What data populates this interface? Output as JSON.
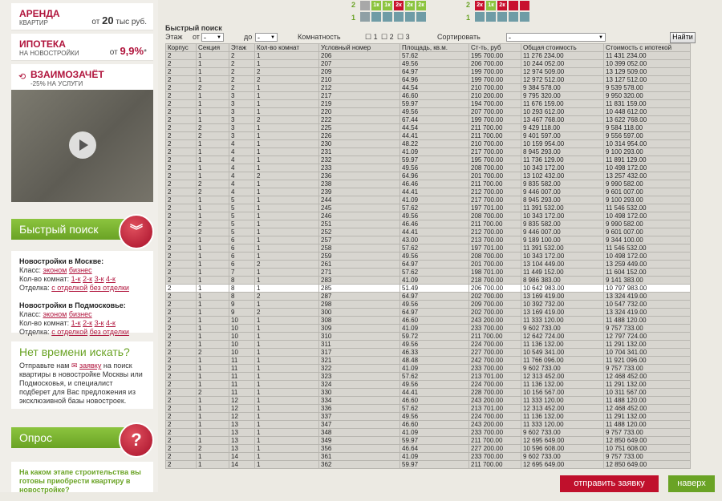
{
  "promos": [
    {
      "title": "АРЕНДА",
      "sub": "КВАРТИР",
      "right_pre": "от ",
      "right_num": "20",
      "right_post": " тыс руб."
    },
    {
      "title": "ИПОТЕКА",
      "sub": "НА НОВОСТРОЙКИ",
      "right_pre": "от ",
      "right_num": "9,9%",
      "right_post": "*"
    },
    {
      "title": "ВЗАИМОЗАЧЁТ",
      "sub": "-25% НА УСЛУГИ",
      "right_pre": "",
      "right_num": "",
      "right_post": ""
    }
  ],
  "quick_search_title": "Быстрый поиск",
  "moscow": {
    "heading": "Новостройки в Москве:",
    "class_label": "Класс:",
    "class_links": [
      "эконом",
      "бизнес"
    ],
    "rooms_label": "Кол-во комнат:",
    "rooms_links": [
      "1-к",
      "2-к",
      "3-к",
      "4-к"
    ],
    "finish_label": "Отделка:",
    "finish_links": [
      "с отделкой",
      "без отделки"
    ]
  },
  "mo": {
    "heading": "Новостройки в Подмосковье:",
    "class_label": "Класс:",
    "class_links": [
      "эконом",
      "бизнес"
    ],
    "rooms_label": "Кол-во комнат:",
    "rooms_links": [
      "1-к",
      "2-к",
      "3-к",
      "4-к"
    ],
    "finish_label": "Отделка:",
    "finish_links": [
      "с отделкой",
      "без отделки"
    ]
  },
  "no_time": {
    "title": "Нет времени искать?",
    "text_pre": "Отправьте нам ",
    "link": "заявку",
    "text_post": " на поиск квартиры в новостройке Москвы или Подмосковья, и специалист подберет для Вас предложения из эксклюзивной базы новостроек."
  },
  "poll_title": "Опрос",
  "poll_question": "На каком этапе строительства вы готовы приобрести квартиру в новостройке?",
  "floor_labels": [
    "2",
    "1",
    "2",
    "1"
  ],
  "grid_badges": [
    "1к",
    "1к",
    "2к",
    "2к",
    "2к",
    "2к",
    "1к",
    "2к"
  ],
  "filters": {
    "title": "Быстрый поиск",
    "floor": "Этаж",
    "from": "от",
    "from_val": "-",
    "to": "до",
    "to_val": "-",
    "rooms": "Комнатность",
    "r1": "1",
    "r2": "2",
    "r3": "3",
    "sort": "Сортировать",
    "sort_val": "-",
    "find": "Найти"
  },
  "columns": [
    "Корпус",
    "Секция",
    "Этаж",
    "Кол-во комнат",
    "Условный номер",
    "Площадь, кв.м.",
    "Ст-ть, руб",
    "Общая стоимость",
    "Стоимость с ипотекой"
  ],
  "rows": [
    [
      "2",
      "1",
      "2",
      "1",
      "206",
      "57.62",
      "195 700.00",
      "11 276 234.00",
      "11 431 234.00"
    ],
    [
      "2",
      "1",
      "2",
      "1",
      "207",
      "49.56",
      "206 700.00",
      "10 244 052.00",
      "10 399 052.00"
    ],
    [
      "2",
      "1",
      "2",
      "2",
      "209",
      "64.97",
      "199 700.00",
      "12 974 509.00",
      "13 129 509.00"
    ],
    [
      "2",
      "1",
      "2",
      "2",
      "210",
      "64.96",
      "199 700.00",
      "12 972 512.00",
      "13 127 512.00"
    ],
    [
      "2",
      "2",
      "2",
      "1",
      "212",
      "44.54",
      "210 700.00",
      "9 384 578.00",
      "9 539 578.00"
    ],
    [
      "2",
      "1",
      "3",
      "1",
      "217",
      "46.60",
      "210 200.00",
      "9 795 320.00",
      "9 950 320.00"
    ],
    [
      "2",
      "1",
      "3",
      "1",
      "219",
      "59.97",
      "194 700.00",
      "11 676 159.00",
      "11 831 159.00"
    ],
    [
      "2",
      "1",
      "3",
      "1",
      "220",
      "49.56",
      "207 700.00",
      "10 293 612.00",
      "10 448 612.00"
    ],
    [
      "2",
      "1",
      "3",
      "2",
      "222",
      "67.44",
      "199 700.00",
      "13 467 768.00",
      "13 622 768.00"
    ],
    [
      "2",
      "2",
      "3",
      "1",
      "225",
      "44.54",
      "211 700.00",
      "9 429 118.00",
      "9 584 118.00"
    ],
    [
      "2",
      "2",
      "3",
      "1",
      "226",
      "44.41",
      "211 700.00",
      "9 401 597.00",
      "9 556 597.00"
    ],
    [
      "2",
      "1",
      "4",
      "1",
      "230",
      "48.22",
      "210 700.00",
      "10 159 954.00",
      "10 314 954.00"
    ],
    [
      "2",
      "1",
      "4",
      "1",
      "231",
      "41.09",
      "217 700.00",
      "8 945 293.00",
      "9 100 293.00"
    ],
    [
      "2",
      "1",
      "4",
      "1",
      "232",
      "59.97",
      "195 700.00",
      "11 736 129.00",
      "11 891 129.00"
    ],
    [
      "2",
      "1",
      "4",
      "1",
      "233",
      "49.56",
      "208 700.00",
      "10 343 172.00",
      "10 498 172.00"
    ],
    [
      "2",
      "1",
      "4",
      "2",
      "236",
      "64.96",
      "201 700.00",
      "13 102 432.00",
      "13 257 432.00"
    ],
    [
      "2",
      "2",
      "4",
      "1",
      "238",
      "46.46",
      "211 700.00",
      "9 835 582.00",
      "9 990 582.00"
    ],
    [
      "2",
      "2",
      "4",
      "1",
      "239",
      "44.41",
      "212 700.00",
      "9 446 007.00",
      "9 601 007.00"
    ],
    [
      "2",
      "1",
      "5",
      "1",
      "244",
      "41.09",
      "217 700.00",
      "8 945 293.00",
      "9 100 293.00"
    ],
    [
      "2",
      "1",
      "5",
      "1",
      "245",
      "57.62",
      "197 701.00",
      "11 391 532.00",
      "11 546 532.00"
    ],
    [
      "2",
      "1",
      "5",
      "1",
      "246",
      "49.56",
      "208 700.00",
      "10 343 172.00",
      "10 498 172.00"
    ],
    [
      "2",
      "2",
      "5",
      "1",
      "251",
      "46.46",
      "211 700.00",
      "9 835 582.00",
      "9 990 582.00"
    ],
    [
      "2",
      "2",
      "5",
      "1",
      "252",
      "44.41",
      "212 700.00",
      "9 446 007.00",
      "9 601 007.00"
    ],
    [
      "2",
      "1",
      "6",
      "1",
      "257",
      "43.00",
      "213 700.00",
      "9 189 100.00",
      "9 344 100.00"
    ],
    [
      "2",
      "1",
      "6",
      "1",
      "258",
      "57.62",
      "197 701.00",
      "11 391 532.00",
      "11 546 532.00"
    ],
    [
      "2",
      "1",
      "6",
      "1",
      "259",
      "49.56",
      "208 700.00",
      "10 343 172.00",
      "10 498 172.00"
    ],
    [
      "2",
      "1",
      "6",
      "2",
      "261",
      "64.97",
      "201 700.00",
      "13 104 449.00",
      "13 259 449.00"
    ],
    [
      "2",
      "1",
      "7",
      "1",
      "271",
      "57.62",
      "198 701.00",
      "11 449 152.00",
      "11 604 152.00"
    ],
    [
      "2",
      "1",
      "8",
      "1",
      "283",
      "41.09",
      "218 700.00",
      "8 986 383.00",
      "9 141 383.00"
    ],
    [
      "2",
      "1",
      "8",
      "1",
      "285",
      "51.49",
      "206 700.00",
      "10 642 983.00",
      "10 797 983.00"
    ],
    [
      "2",
      "1",
      "8",
      "2",
      "287",
      "64.97",
      "202 700.00",
      "13 169 419.00",
      "13 324 419.00"
    ],
    [
      "2",
      "1",
      "9",
      "1",
      "298",
      "49.56",
      "209 700.00",
      "10 392 732.00",
      "10 547 732.00"
    ],
    [
      "2",
      "1",
      "9",
      "2",
      "300",
      "64.97",
      "202 700.00",
      "13 169 419.00",
      "13 324 419.00"
    ],
    [
      "2",
      "1",
      "10",
      "1",
      "308",
      "46.60",
      "243 200.00",
      "11 333 120.00",
      "11 488 120.00"
    ],
    [
      "2",
      "1",
      "10",
      "1",
      "309",
      "41.09",
      "233 700.00",
      "9 602 733.00",
      "9 757 733.00"
    ],
    [
      "2",
      "1",
      "10",
      "1",
      "310",
      "59.72",
      "211 700.00",
      "12 642 724.00",
      "12 797 724.00"
    ],
    [
      "2",
      "1",
      "10",
      "1",
      "311",
      "49.56",
      "224 700.00",
      "11 136 132.00",
      "11 291 132.00"
    ],
    [
      "2",
      "2",
      "10",
      "1",
      "317",
      "46.33",
      "227 700.00",
      "10 549 341.00",
      "10 704 341.00"
    ],
    [
      "2",
      "1",
      "11",
      "1",
      "321",
      "48.48",
      "242 700.00",
      "11 766 096.00",
      "11 921 096.00"
    ],
    [
      "2",
      "1",
      "11",
      "1",
      "322",
      "41.09",
      "233 700.00",
      "9 602 733.00",
      "9 757 733.00"
    ],
    [
      "2",
      "1",
      "11",
      "1",
      "323",
      "57.62",
      "213 701.00",
      "12 313 452.00",
      "12 468 452.00"
    ],
    [
      "2",
      "1",
      "11",
      "1",
      "324",
      "49.56",
      "224 700.00",
      "11 136 132.00",
      "11 291 132.00"
    ],
    [
      "2",
      "2",
      "11",
      "1",
      "330",
      "44.41",
      "228 700.00",
      "10 156 567.00",
      "10 311 567.00"
    ],
    [
      "2",
      "1",
      "12",
      "1",
      "334",
      "46.60",
      "243 200.00",
      "11 333 120.00",
      "11 488 120.00"
    ],
    [
      "2",
      "1",
      "12",
      "1",
      "336",
      "57.62",
      "213 701.00",
      "12 313 452.00",
      "12 468 452.00"
    ],
    [
      "2",
      "1",
      "12",
      "1",
      "337",
      "49.56",
      "224 700.00",
      "11 136 132.00",
      "11 291 132.00"
    ],
    [
      "2",
      "1",
      "13",
      "1",
      "347",
      "46.60",
      "243 200.00",
      "11 333 120.00",
      "11 488 120.00"
    ],
    [
      "2",
      "1",
      "13",
      "1",
      "348",
      "41.09",
      "233 700.00",
      "9 602 733.00",
      "9 757 733.00"
    ],
    [
      "2",
      "1",
      "13",
      "1",
      "349",
      "59.97",
      "211 700.00",
      "12 695 649.00",
      "12 850 649.00"
    ],
    [
      "2",
      "2",
      "13",
      "1",
      "356",
      "46.64",
      "227 200.00",
      "10 596 608.00",
      "10 751 608.00"
    ],
    [
      "2",
      "1",
      "14",
      "1",
      "361",
      "41.09",
      "233 700.00",
      "9 602 733.00",
      "9 757 733.00"
    ],
    [
      "2",
      "1",
      "14",
      "1",
      "362",
      "59.97",
      "211 700.00",
      "12 695 649.00",
      "12 850 649.00"
    ]
  ],
  "highlight_row": 29,
  "footer": {
    "request": "отправить заявку",
    "up": "наверх"
  }
}
